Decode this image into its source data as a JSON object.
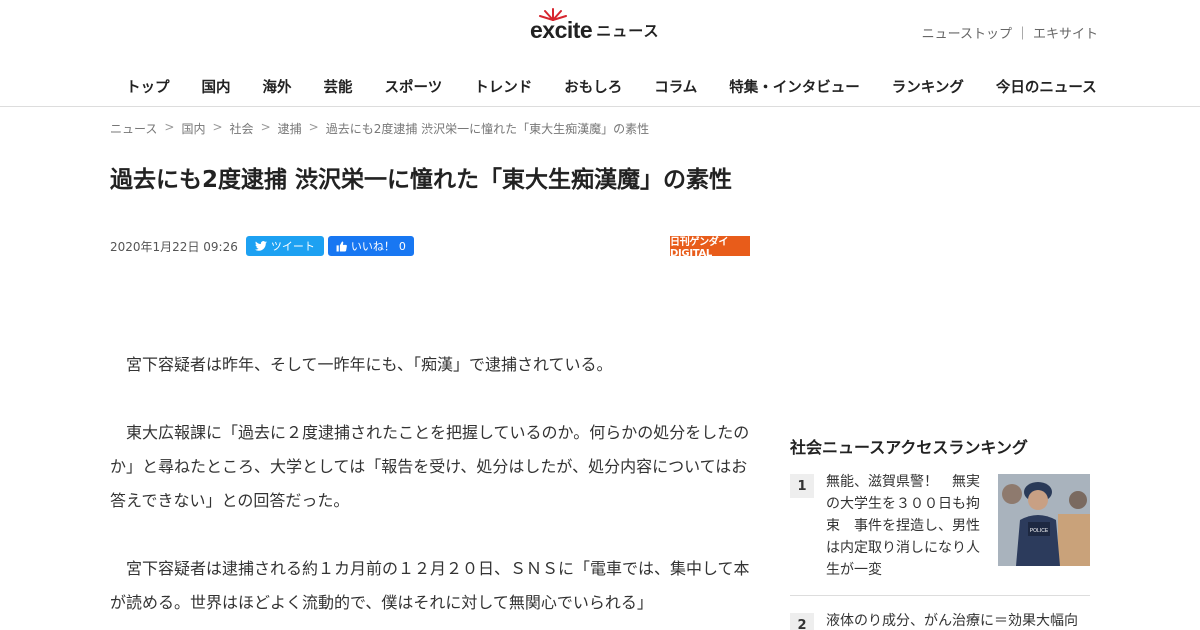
{
  "header": {
    "logo_text": "excite",
    "logo_sub": "ニュース",
    "links": [
      "ニューストップ",
      "｜",
      "エキサイト"
    ]
  },
  "nav": [
    "トップ",
    "国内",
    "海外",
    "芸能",
    "スポーツ",
    "トレンド",
    "おもしろ",
    "コラム",
    "特集・インタビュー",
    "ランキング",
    "今日のニュース"
  ],
  "breadcrumb": [
    "ニュース",
    ">",
    "国内",
    ">",
    "社会",
    ">",
    "逮捕",
    ">",
    "過去にも2度逮捕 渋沢栄一に憧れた「東大生痴漢魔」の素性"
  ],
  "article": {
    "title": "過去にも2度逮捕 渋沢栄一に憧れた「東大生痴漢魔」の素性",
    "date": "2020年1月22日 09:26",
    "tweet_label": "ツイート",
    "like_label": "いいね！",
    "like_count": "0",
    "source_logo": "日刊ゲンダイDIGITAL",
    "paragraphs": [
      "宮下容疑者は昨年、そして一昨年にも、「痴漢」で逮捕されている。",
      "東大広報課に「過去に２度逮捕されたことを把握しているのか。何らかの処分をしたのか」と尋ねたところ、大学としては「報告を受け、処分はしたが、処分内容についてはお答えできない」との回答だった。",
      "宮下容疑者は逮捕される約１カ月前の１２月２０日、ＳＮＳに「電車では、集中して本が読める。世界はほどよく流動的で、僕はそれに対して無関心でいられる」"
    ]
  },
  "sidebar": {
    "ranking_title": "社会ニュースアクセスランキング",
    "items": [
      {
        "rank": "1",
        "text": "無能、滋賀県警！　無実の大学生を３００日も拘束　事件を捏造し、男性は内定取り消しになり人生が一変",
        "thumb_label": "POLICE"
      },
      {
        "rank": "2",
        "text": "液体のり成分、がん治療に＝効果大幅向"
      }
    ]
  },
  "colors": {
    "tweet": "#1da1f2",
    "like": "#1877f2",
    "source": "#e85c1a"
  }
}
